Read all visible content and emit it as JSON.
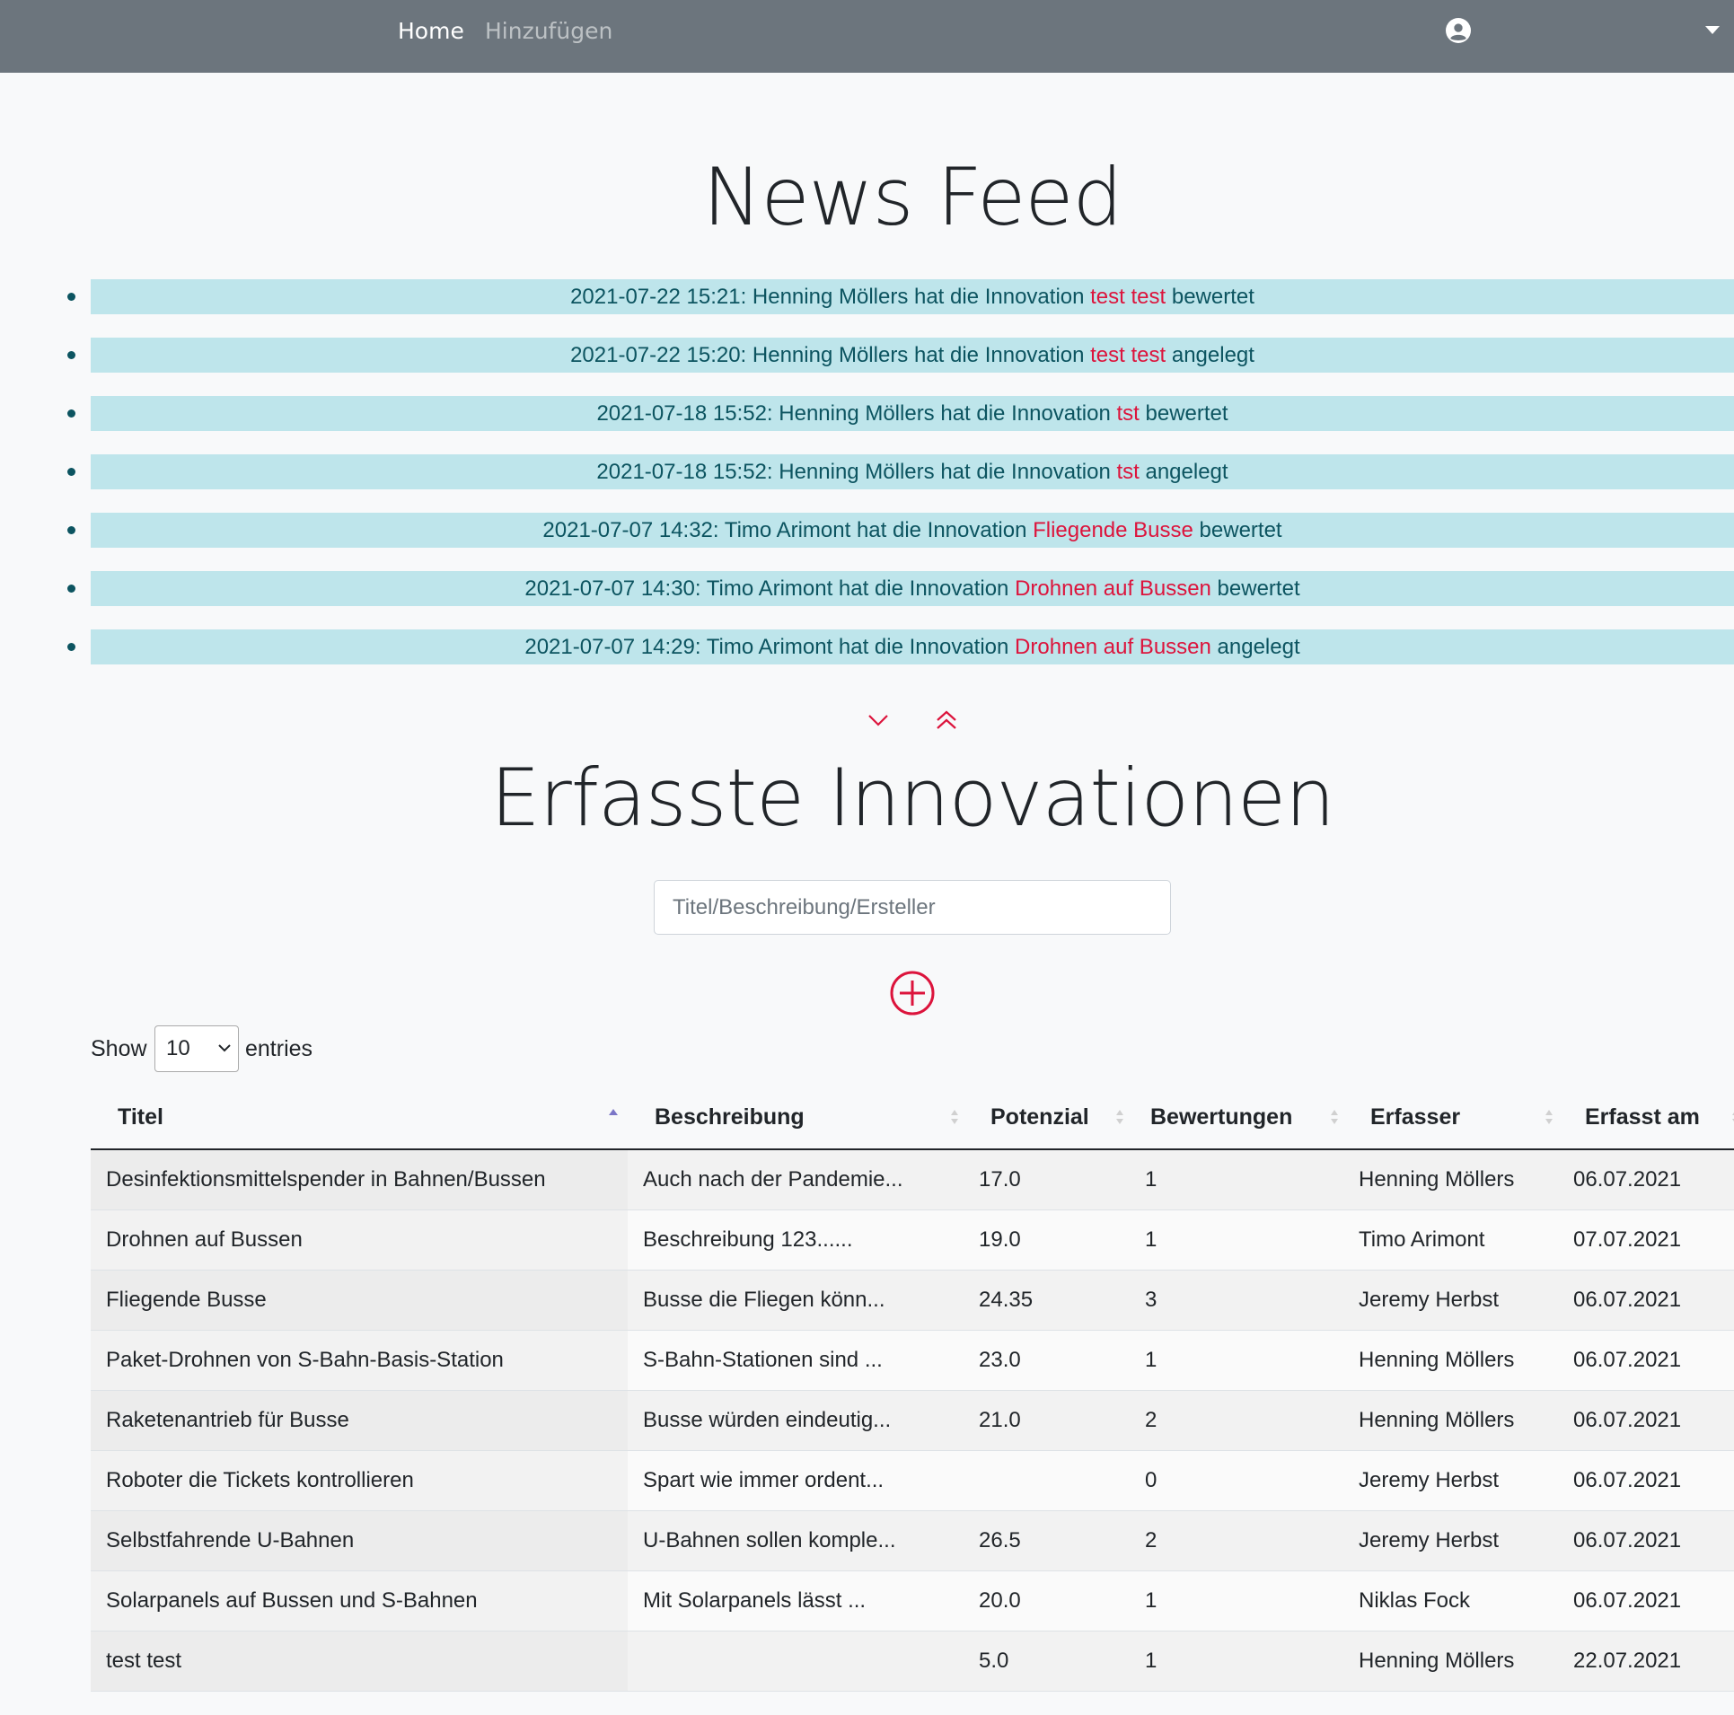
{
  "nav": {
    "home_label": "Home",
    "add_label": "Hinzufügen",
    "user_icon": "user-circle-icon",
    "dropdown_icon": "caret-down-icon"
  },
  "news": {
    "title": "News Feed",
    "items": [
      {
        "prefix": "2021-07-22 15:21: Henning Möllers hat die Innovation ",
        "innovation": "test test",
        "suffix": " bewertet"
      },
      {
        "prefix": "2021-07-22 15:20: Henning Möllers hat die Innovation ",
        "innovation": "test test",
        "suffix": " angelegt"
      },
      {
        "prefix": "2021-07-18 15:52: Henning Möllers hat die Innovation ",
        "innovation": "tst",
        "suffix": " bewertet"
      },
      {
        "prefix": "2021-07-18 15:52: Henning Möllers hat die Innovation ",
        "innovation": "tst",
        "suffix": " angelegt"
      },
      {
        "prefix": "2021-07-07 14:32: Timo Arimont hat die Innovation ",
        "innovation": "Fliegende Busse",
        "suffix": " bewertet"
      },
      {
        "prefix": "2021-07-07 14:30: Timo Arimont hat die Innovation ",
        "innovation": "Drohnen auf Bussen",
        "suffix": " bewertet"
      },
      {
        "prefix": "2021-07-07 14:29: Timo Arimont hat die Innovation ",
        "innovation": "Drohnen auf Bussen",
        "suffix": " angelegt"
      }
    ],
    "show_more_icon": "chevron-down-icon",
    "show_less_icon": "chevrons-up-icon"
  },
  "innovations": {
    "title": "Erfasste Innovationen",
    "search_placeholder": "Titel/Beschreibung/Ersteller",
    "add_icon": "plus-circle-icon",
    "show_label": "Show",
    "entries_value": "10",
    "entries_label": "entries",
    "columns": [
      "Titel",
      "Beschreibung",
      "Potenzial",
      "Bewertungen",
      "Erfasser",
      "Erfasst am"
    ],
    "rows": [
      {
        "titel": "Desinfektionsmittelspender in Bahnen/Bussen",
        "beschreibung": "Auch nach der Pandemie...",
        "potenzial": "17.0",
        "bewertungen": "1",
        "erfasser": "Henning Möllers",
        "erfasst_am": "06.07.2021"
      },
      {
        "titel": "Drohnen auf Bussen",
        "beschreibung": "Beschreibung 123......",
        "potenzial": "19.0",
        "bewertungen": "1",
        "erfasser": "Timo Arimont",
        "erfasst_am": "07.07.2021"
      },
      {
        "titel": "Fliegende Busse",
        "beschreibung": "Busse die Fliegen könn...",
        "potenzial": "24.35",
        "bewertungen": "3",
        "erfasser": "Jeremy Herbst",
        "erfasst_am": "06.07.2021"
      },
      {
        "titel": "Paket-Drohnen von S-Bahn-Basis-Station",
        "beschreibung": "S-Bahn-Stationen sind ...",
        "potenzial": "23.0",
        "bewertungen": "1",
        "erfasser": "Henning Möllers",
        "erfasst_am": "06.07.2021"
      },
      {
        "titel": "Raketenantrieb für Busse",
        "beschreibung": "Busse würden eindeutig...",
        "potenzial": "21.0",
        "bewertungen": "2",
        "erfasser": "Henning Möllers",
        "erfasst_am": "06.07.2021"
      },
      {
        "titel": "Roboter die Tickets kontrollieren",
        "beschreibung": "Spart wie immer ordent...",
        "potenzial": "",
        "bewertungen": "0",
        "erfasser": "Jeremy Herbst",
        "erfasst_am": "06.07.2021"
      },
      {
        "titel": "Selbstfahrende U-Bahnen",
        "beschreibung": "U-Bahnen sollen komple...",
        "potenzial": "26.5",
        "bewertungen": "2",
        "erfasser": "Jeremy Herbst",
        "erfasst_am": "06.07.2021"
      },
      {
        "titel": "Solarpanels auf Bussen und S-Bahnen",
        "beschreibung": "Mit Solarpanels lässt ...",
        "potenzial": "20.0",
        "bewertungen": "1",
        "erfasser": "Niklas Fock",
        "erfasst_am": "06.07.2021"
      },
      {
        "titel": "test test",
        "beschreibung": "",
        "potenzial": "5.0",
        "bewertungen": "1",
        "erfasser": "Henning Möllers",
        "erfasst_am": "22.07.2021"
      }
    ]
  },
  "colors": {
    "navbar": "#6c757d",
    "news_bar_bg": "#bee5eb",
    "news_text": "#0c5460",
    "accent": "#dc143c"
  }
}
